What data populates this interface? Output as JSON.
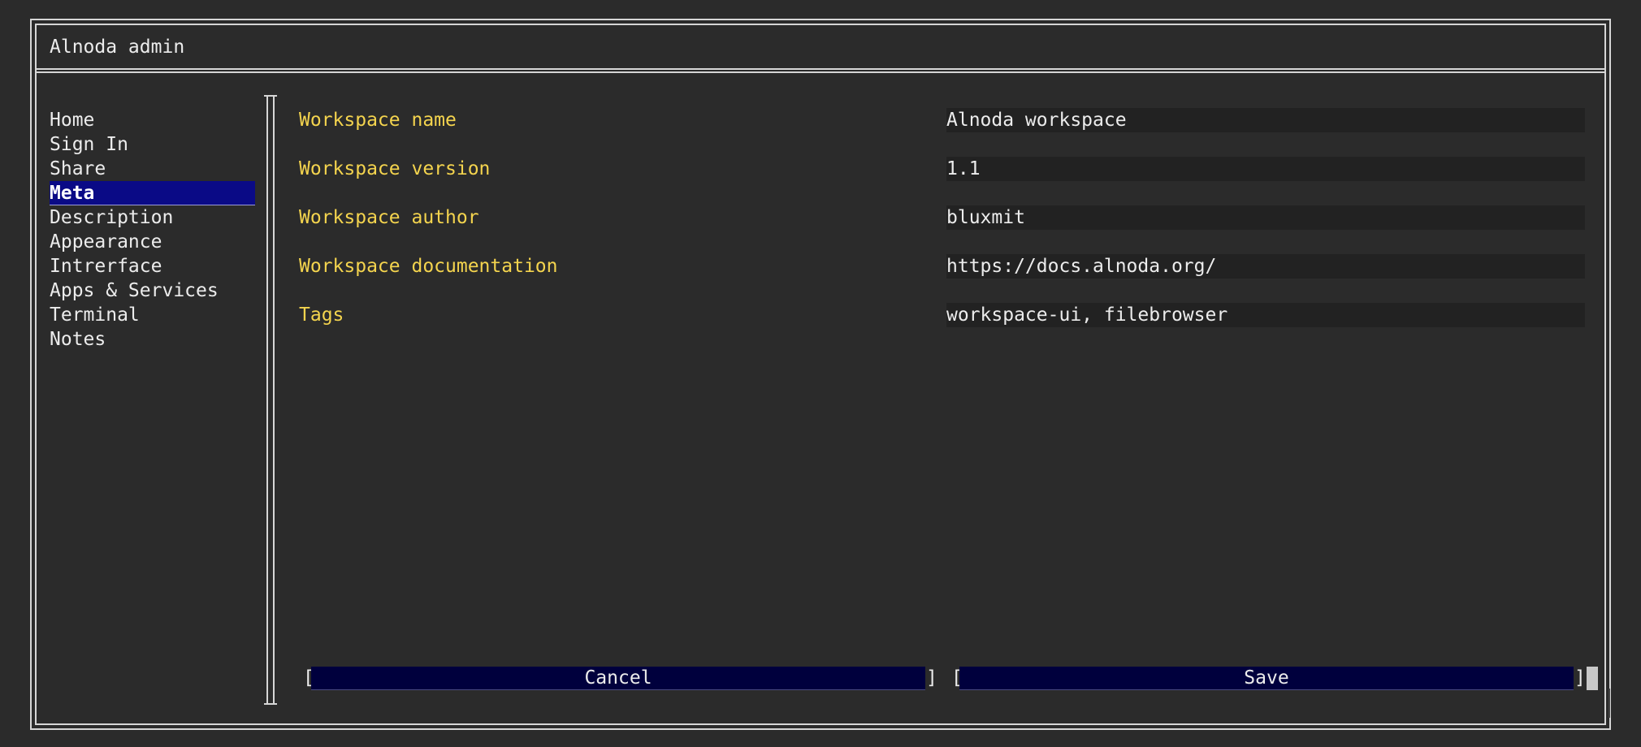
{
  "window": {
    "title": "Alnoda admin"
  },
  "sidebar": {
    "items": [
      {
        "label": "Home",
        "active": false
      },
      {
        "label": "Sign In",
        "active": false
      },
      {
        "label": "Share",
        "active": false
      },
      {
        "label": "Meta",
        "active": true
      },
      {
        "label": "Description",
        "active": false
      },
      {
        "label": "Appearance",
        "active": false
      },
      {
        "label": "Intrerface",
        "active": false
      },
      {
        "label": "Apps & Services",
        "active": false
      },
      {
        "label": "Terminal",
        "active": false
      },
      {
        "label": "Notes",
        "active": false
      }
    ]
  },
  "form": {
    "fields": [
      {
        "label": "Workspace name",
        "value": "Alnoda workspace"
      },
      {
        "label": "Workspace version",
        "value": "1.1"
      },
      {
        "label": "Workspace author",
        "value": "bluxmit"
      },
      {
        "label": "Workspace documentation",
        "value": "https://docs.alnoda.org/"
      },
      {
        "label": "Tags",
        "value": "workspace-ui, filebrowser"
      }
    ]
  },
  "actions": {
    "cancel_label": "Cancel",
    "save_label": "Save",
    "bracket_open": "[",
    "bracket_close": "]"
  },
  "colors": {
    "background": "#2b2b2b",
    "label_yellow": "#f4d44e",
    "active_nav": "#0a0a86",
    "button_bg": "#00003d"
  }
}
